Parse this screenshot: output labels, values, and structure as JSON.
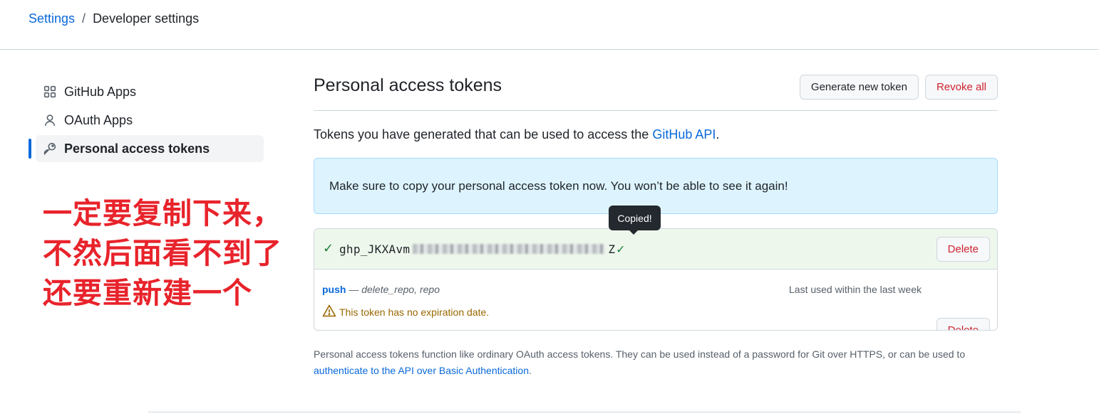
{
  "breadcrumb": {
    "settings": "Settings",
    "separator": "/",
    "current": "Developer settings"
  },
  "sidebar": {
    "items": [
      {
        "label": "GitHub Apps",
        "icon": "apps-grid-icon"
      },
      {
        "label": "OAuth Apps",
        "icon": "person-icon"
      },
      {
        "label": "Personal access tokens",
        "icon": "key-icon",
        "active": true
      }
    ]
  },
  "annotation": {
    "line1": "一定要复制下来，",
    "line2": "不然后面看不到了",
    "line3": "还要重新建一个",
    "color": "#e8232b"
  },
  "main": {
    "title": "Personal access tokens",
    "generate_label": "Generate new token",
    "revoke_label": "Revoke all",
    "intro_text": "Tokens you have generated that can be used to access the ",
    "intro_link": "GitHub API",
    "intro_end": ".",
    "flash_text": "Make sure to copy your personal access token now. You won’t be able to see it again!",
    "tooltip": "Copied!",
    "new_token": {
      "prefix": "ghp_JKXAvm",
      "suffix": "Z",
      "delete_label": "Delete"
    },
    "token": {
      "name": "push",
      "dash": " — ",
      "scopes": "delete_repo, repo",
      "last_used": "Last used within the last week",
      "warning": "This token has no expiration date.",
      "delete_label": "Delete"
    },
    "footer_text": "Personal access tokens function like ordinary OAuth access tokens. They can be used instead of a password for Git over HTTPS, or can be used to ",
    "footer_link": "authenticate to the API over Basic Authentication",
    "footer_end": "."
  },
  "colors": {
    "accent": "#0969da",
    "danger": "#cf222e",
    "success": "#1a7f37",
    "warning": "#9a6700",
    "flash_bg": "#ddf4ff"
  }
}
